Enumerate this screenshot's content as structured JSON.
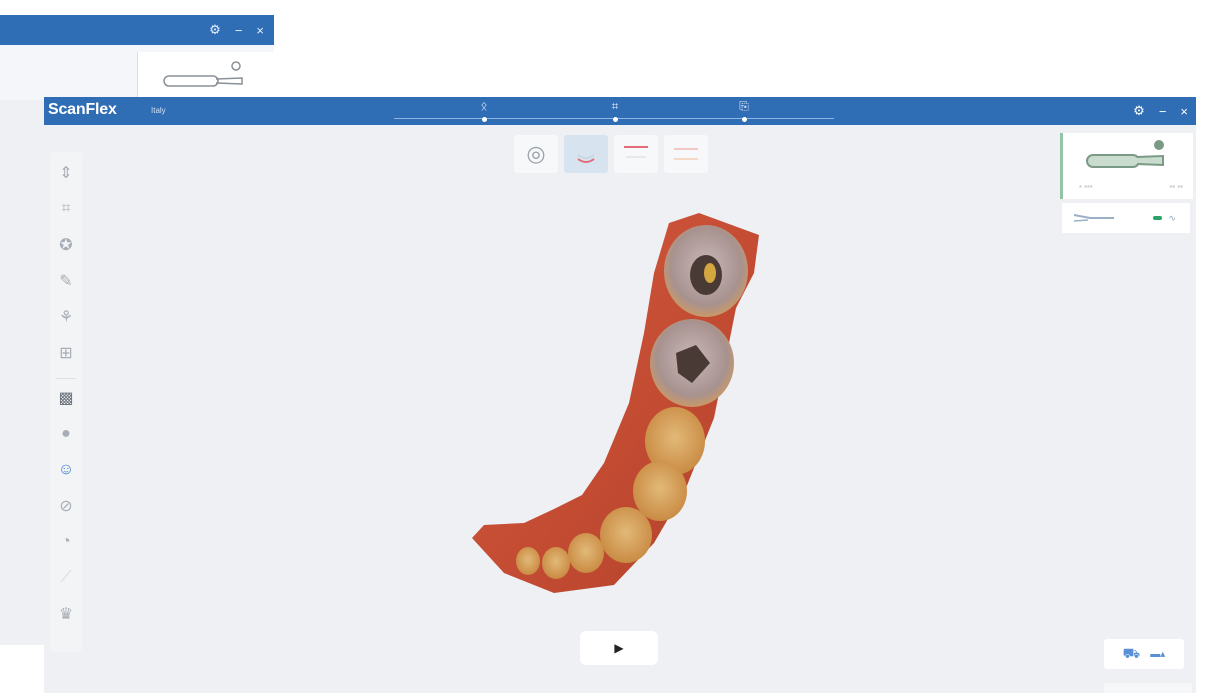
{
  "background_window": {
    "controls": {
      "settings_icon": "gear-icon",
      "minimize": "−",
      "close": "×"
    },
    "scanner_icon": "scanner-handpiece-icon"
  },
  "app": {
    "title": "ScanFlex",
    "subtitle": "Italy",
    "accent_color": "#2f6db5"
  },
  "workflow_steps": [
    {
      "icon": "scan-step-icon",
      "glyph": "ᛟ"
    },
    {
      "icon": "trim-step-icon",
      "glyph": "⌗"
    },
    {
      "icon": "export-step-icon",
      "glyph": "⎘"
    }
  ],
  "window_controls": {
    "settings_icon": "gear-icon",
    "minimize": "−",
    "close": "×"
  },
  "view_buttons": [
    {
      "icon": "orientation-icon",
      "glyph": "◎",
      "selected": false
    },
    {
      "icon": "lower-jaw-icon",
      "glyph": "",
      "selected": true
    },
    {
      "icon": "upper-jaw-icon",
      "glyph": "",
      "selected": false
    },
    {
      "icon": "bite-icon",
      "glyph": "",
      "selected": false
    }
  ],
  "left_toolbar": [
    {
      "icon": "grip-icon",
      "glyph": "⇕",
      "tone": "normal"
    },
    {
      "icon": "crop-icon",
      "glyph": "⌗",
      "tone": "normal"
    },
    {
      "icon": "lasso-icon",
      "glyph": "✪",
      "tone": "normal"
    },
    {
      "icon": "eraser-icon",
      "glyph": "✎",
      "tone": "normal"
    },
    {
      "icon": "tooth-icon",
      "glyph": "⚘",
      "tone": "normal"
    },
    {
      "icon": "implant-icon",
      "glyph": "⊞",
      "tone": "normal"
    },
    {
      "icon": "texture-icon",
      "glyph": "▩",
      "tone": "dark"
    },
    {
      "icon": "shade-icon",
      "glyph": "●",
      "tone": "normal"
    },
    {
      "icon": "smile-icon",
      "glyph": "☺",
      "tone": "active"
    },
    {
      "icon": "measure-icon",
      "glyph": "⊘",
      "tone": "normal"
    },
    {
      "icon": "refine-icon",
      "glyph": "◔",
      "tone": "normal"
    },
    {
      "icon": "brush-icon",
      "glyph": "⟋",
      "tone": "faded"
    },
    {
      "icon": "settings-tooth-icon",
      "glyph": "♛",
      "tone": "normal"
    }
  ],
  "scanner_panel": {
    "icon": "scanner-handpiece-icon",
    "status_color": "#29a36a"
  },
  "play_button": {
    "glyph": "▶"
  },
  "bottom_right": {
    "icon": "model-view-icon",
    "glyph": "⛟"
  }
}
